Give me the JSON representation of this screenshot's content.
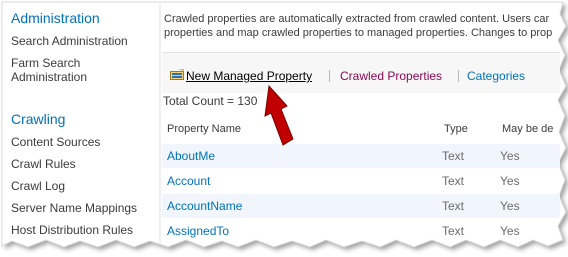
{
  "sidebar": {
    "sections": [
      {
        "heading": "Administration",
        "items": [
          "Search Administration",
          "Farm Search Administration"
        ]
      },
      {
        "heading": "Crawling",
        "items": [
          "Content Sources",
          "Crawl Rules",
          "Crawl Log",
          "Server Name Mappings",
          "Host Distribution Rules"
        ]
      }
    ]
  },
  "main": {
    "description_line1": "Crawled properties are automatically extracted from crawled content. Users car",
    "description_line2": "properties and map crawled properties to managed properties. Changes to prop",
    "toolbar": {
      "new_label": "New Managed Property",
      "crawled_label": "Crawled Properties",
      "categories_label": "Categories"
    },
    "total_count": "Total Count = 130",
    "table": {
      "columns": [
        "Property Name",
        "Type",
        "May be de"
      ],
      "rows": [
        {
          "name": "AboutMe",
          "type": "Text",
          "may_be": "Yes"
        },
        {
          "name": "Account",
          "type": "Text",
          "may_be": "Yes"
        },
        {
          "name": "AccountName",
          "type": "Text",
          "may_be": "Yes"
        },
        {
          "name": "AssignedTo",
          "type": "Text",
          "may_be": "Yes"
        }
      ]
    }
  },
  "colors": {
    "heading": "#0072bc",
    "link": "#0072bc",
    "visited_link": "#8b0a54",
    "arrow": "#c00000",
    "toolbar_bg": "#f7f7f7",
    "row_alt_bg": "#f0f6fb"
  },
  "icons": {
    "new_property": "new-managed-property-icon",
    "annotation": "red-arrow-icon"
  }
}
